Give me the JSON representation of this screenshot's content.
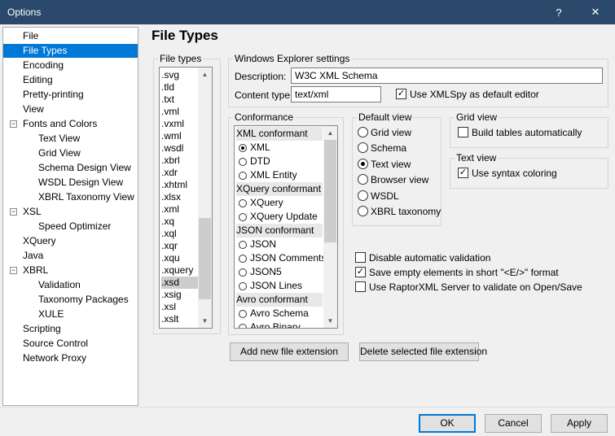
{
  "window": {
    "title": "Options",
    "help_label": "?",
    "close_label": "✕"
  },
  "tree": {
    "items": [
      {
        "label": "File"
      },
      {
        "label": "File Types"
      },
      {
        "label": "Encoding"
      },
      {
        "label": "Editing"
      },
      {
        "label": "Pretty-printing"
      },
      {
        "label": "View"
      },
      {
        "label": "Fonts and Colors"
      },
      {
        "label": "Text View"
      },
      {
        "label": "Grid View"
      },
      {
        "label": "Schema Design View"
      },
      {
        "label": "WSDL Design View"
      },
      {
        "label": "XBRL Taxonomy View"
      },
      {
        "label": "XSL"
      },
      {
        "label": "Speed Optimizer"
      },
      {
        "label": "XQuery"
      },
      {
        "label": "Java"
      },
      {
        "label": "XBRL"
      },
      {
        "label": "Validation"
      },
      {
        "label": "Taxonomy Packages"
      },
      {
        "label": "XULE"
      },
      {
        "label": "Scripting"
      },
      {
        "label": "Source Control"
      },
      {
        "label": "Network Proxy"
      }
    ]
  },
  "page_title": "File Types",
  "file_types": {
    "legend": "File types",
    "items": [
      ".svg",
      ".tld",
      ".txt",
      ".vml",
      ".vxml",
      ".wml",
      ".wsdl",
      ".xbrl",
      ".xdr",
      ".xhtml",
      ".xlsx",
      ".xml",
      ".xq",
      ".xql",
      ".xqr",
      ".xqu",
      ".xquery",
      ".xsd",
      ".xsig",
      ".xsl",
      ".xslt"
    ],
    "selected": ".xsd"
  },
  "explorer": {
    "legend": "Windows Explorer settings",
    "description_label": "Description:",
    "description_value": "W3C XML Schema",
    "content_type_label": "Content type:",
    "content_type_value": "text/xml",
    "use_default_editor_label": "Use XMLSpy as default editor",
    "use_default_editor_checked": true
  },
  "conformance": {
    "legend": "Conformance",
    "groups": [
      {
        "header": "XML conformant",
        "options": [
          "XML",
          "DTD",
          "XML Entity"
        ]
      },
      {
        "header": "XQuery conformant",
        "options": [
          "XQuery",
          "XQuery Update"
        ]
      },
      {
        "header": "JSON conformant",
        "options": [
          "JSON",
          "JSON Comments",
          "JSON5",
          "JSON Lines"
        ]
      },
      {
        "header": "Avro conformant",
        "options": [
          "Avro Schema",
          "Avro Binary"
        ]
      }
    ],
    "selected": "XML"
  },
  "default_view": {
    "legend": "Default view",
    "options": [
      "Grid view",
      "Schema",
      "Text view",
      "Browser view",
      "WSDL",
      "XBRL taxonomy"
    ],
    "selected": "Text view"
  },
  "grid_view": {
    "legend": "Grid view",
    "build_tables_label": "Build tables automatically",
    "build_tables_checked": false
  },
  "text_view": {
    "legend": "Text view",
    "syntax_coloring_label": "Use syntax coloring",
    "syntax_coloring_checked": true
  },
  "options": [
    {
      "label": "Disable automatic validation",
      "checked": false
    },
    {
      "label": "Save empty elements in short \"<E/>\" format",
      "checked": true
    },
    {
      "label": "Use RaptorXML Server to validate on Open/Save",
      "checked": false
    }
  ],
  "buttons": {
    "add_extension": "Add new file extension",
    "delete_extension": "Delete selected file extension",
    "ok": "OK",
    "cancel": "Cancel",
    "apply": "Apply"
  },
  "colors": {
    "accent": "#0078d7",
    "titlebar": "#2b4a6b"
  }
}
